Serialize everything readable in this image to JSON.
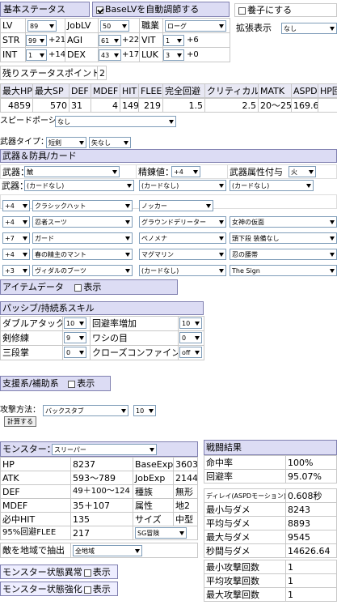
{
  "basic": {
    "title": "基本ステータス",
    "auto_adjust_label": "BaseLVを自動調節する",
    "adopt_label": "養子にする",
    "lv_label": "LV",
    "lv_value": "89",
    "joblv_label": "JobLV",
    "joblv_value": "50",
    "job_label": "職業",
    "job_value": "ローグ",
    "ext_label": "拡張表示",
    "ext_value": "なし",
    "stats": [
      {
        "label": "STR",
        "base": "99",
        "bonus": "+21"
      },
      {
        "label": "AGI",
        "base": "61",
        "bonus": "+22"
      },
      {
        "label": "VIT",
        "base": "1",
        "bonus": "+6"
      },
      {
        "label": "INT",
        "base": "1",
        "bonus": "+14"
      },
      {
        "label": "DEX",
        "base": "43",
        "bonus": "+17"
      },
      {
        "label": "LUK",
        "base": "3",
        "bonus": "+0"
      }
    ],
    "remaining_label": "残りステータスポイント",
    "remaining_value": "2"
  },
  "derived": {
    "headers": [
      "最大HP",
      "最大SP",
      "DEF",
      "MDEF",
      "HIT",
      "FLEE",
      "完全回避",
      "クリティカル",
      "MATK",
      "ASPD",
      "HP回"
    ],
    "values": [
      "4859",
      "570",
      "31",
      "4",
      "149",
      "219",
      "1.5",
      "2.5",
      "20〜25",
      "169.6",
      ""
    ]
  },
  "potion": {
    "label": "スピードポーション：",
    "value": "なし"
  },
  "weapon_type": {
    "label": "武器タイプ：",
    "value": "短剣",
    "value2": "矢なし"
  },
  "equip": {
    "title": "武器＆防具/カード",
    "weapon_label": "武器：",
    "weapon_value": "鯱",
    "refine_label": "精錬値：",
    "refine_value": "+4",
    "element_label": "武器属性付与",
    "element_value": "火",
    "card_label": "武器：",
    "cards": [
      "(カードなし)",
      "(カードなし)",
      "(カードなし)",
      "(カードなし)"
    ],
    "rows": [
      {
        "refine": "+4",
        "item": "クラシックハット",
        "card": "ノッカー",
        "extra": ""
      },
      {
        "refine": "+4",
        "item": "忍者スーツ",
        "card": "グラウンドデリーター",
        "extra": "女神の仮面"
      },
      {
        "refine": "+7",
        "item": "ガード",
        "card": "ペノメナ",
        "extra": "頭下段 装備なし"
      },
      {
        "refine": "+4",
        "item": "春の精主のマント",
        "card": "マグマリン",
        "extra": "忍の腰帯"
      },
      {
        "refine": "+3",
        "item": "ヴィダルのブーツ",
        "card": "(カードなし)",
        "extra": "The Sign"
      }
    ]
  },
  "item_data": {
    "title": "アイテムデータ",
    "show_label": "表示"
  },
  "skills": {
    "title": "パッシブ/持続系スキル",
    "rows": [
      {
        "name": "ダブルアタック",
        "value": "10",
        "name2": "回避率増加",
        "value2": "10"
      },
      {
        "name": "剣修練",
        "value": "9",
        "name2": "ワシの目",
        "value2": "0"
      },
      {
        "name": "三段掌",
        "value": "0",
        "name2": "クローズコンファイン",
        "value2": "off"
      }
    ]
  },
  "support": {
    "title": "支援系/補助系",
    "show_label": "表示"
  },
  "attack": {
    "label": "攻撃方法：",
    "value": "バックスタブ",
    "level": "10",
    "calc_button": "計算する"
  },
  "monster": {
    "label": "モンスター：",
    "value": "スリーパー",
    "rows": [
      {
        "k": "HP",
        "v": "8237",
        "k2": "BaseExp",
        "v2": "3603"
      },
      {
        "k": "ATK",
        "v": "593〜789",
        "k2": "JobExp",
        "v2": "2144"
      },
      {
        "k": "DEF",
        "v": "49＋100〜124",
        "k2": "種族",
        "v2": "無形"
      },
      {
        "k": "MDEF",
        "v": "35＋107",
        "k2": "属性",
        "v2": "地2"
      },
      {
        "k": "必中HIT",
        "v": "135",
        "k2": "サイズ",
        "v2": "中型"
      },
      {
        "k": "95%回避FLEE",
        "v": "217",
        "k2": "",
        "v2": "SG冒険"
      }
    ],
    "filter_label": "敵を地域で抽出",
    "filter_value": "全地域",
    "status_label": "モンスター状態異常",
    "status_show": "表示",
    "buff_label": "モンスター状態強化",
    "buff_show": "表示"
  },
  "result": {
    "title": "戦闘結果",
    "rows": [
      {
        "k": "命中率",
        "v": "100%"
      },
      {
        "k": "回避率",
        "v": "95.07%"
      },
      {
        "k": "ディレイ(ASPDモーション)",
        "v": "0.608秒"
      },
      {
        "k": "最小与ダメ",
        "v": "8243"
      },
      {
        "k": "平均与ダメ",
        "v": "8893"
      },
      {
        "k": "最大与ダメ",
        "v": "9545"
      },
      {
        "k": "秒間与ダメ",
        "v": "14626.64"
      },
      {
        "k": "最小攻撃回数",
        "v": "1"
      },
      {
        "k": "平均攻撃回数",
        "v": "1"
      },
      {
        "k": "最大攻撃回数",
        "v": "1"
      }
    ]
  }
}
